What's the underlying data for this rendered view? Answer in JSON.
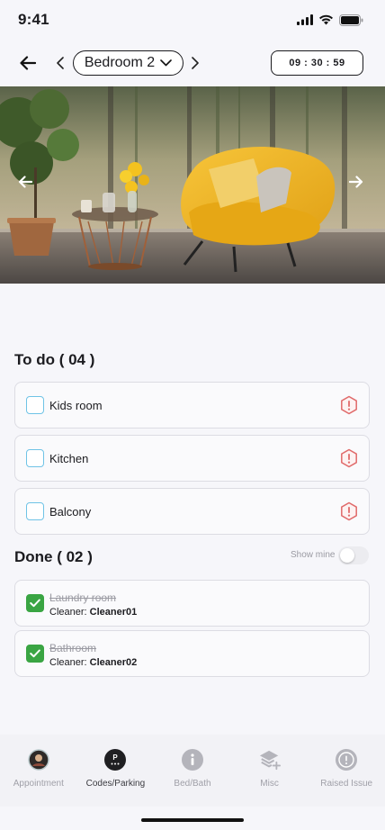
{
  "status_bar": {
    "time": "9:41",
    "icons": [
      "signal-icon",
      "wifi-icon",
      "battery-icon"
    ]
  },
  "header": {
    "back_icon": "arrow-left-icon",
    "room": "Bedroom 2",
    "timer": "09 : 30 : 59"
  },
  "hero": {
    "left_arrow": "arrow-left-icon",
    "right_arrow": "arrow-right-icon"
  },
  "todo": {
    "title": "To do ( 04 )",
    "items": [
      {
        "label": "Kids room",
        "checked": false
      },
      {
        "label": "Kitchen",
        "checked": false
      },
      {
        "label": "Balcony",
        "checked": false
      }
    ]
  },
  "done": {
    "title": "Done ( 02 )",
    "show_mine_label": "Show mine",
    "show_mine_on": false,
    "items": [
      {
        "title": "Laundry room",
        "cleaner_prefix": "Cleaner:",
        "cleaner_name": "Cleaner01",
        "checked": true
      },
      {
        "title": "Bathroom",
        "cleaner_prefix": "Cleaner:",
        "cleaner_name": "Cleaner02",
        "checked": true
      }
    ]
  },
  "bottom_nav": {
    "items": [
      {
        "label": "Appointment",
        "icon": "avatar-icon",
        "active": false
      },
      {
        "label": "Codes/Parking",
        "icon": "parking-icon",
        "active": true
      },
      {
        "label": "Bed/Bath",
        "icon": "info-icon",
        "active": false
      },
      {
        "label": "Misc",
        "icon": "layers-add-icon",
        "active": false
      },
      {
        "label": "Raised Issue",
        "icon": "alert-circle-icon",
        "active": false
      }
    ]
  },
  "colors": {
    "accent_check": "#3aa543",
    "checkbox_border": "#6fc3e6",
    "warning": "#e06a6a",
    "hero_chair": "#f0b320"
  }
}
